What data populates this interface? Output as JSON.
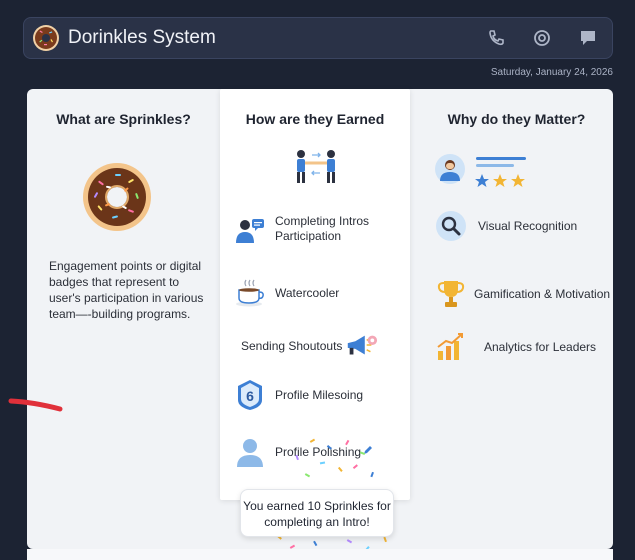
{
  "header": {
    "title": "Dorinkles System",
    "date": "Saturday, January 24, 2026",
    "actions": [
      "phone-icon",
      "settings-icon",
      "chat-icon"
    ]
  },
  "columns": {
    "left": {
      "title": "What are Sprinkles?",
      "definition": "Engagement points or digital badges that represent to user's participation in various team—-building programs."
    },
    "middle": {
      "title": "How are they Earned",
      "items": [
        {
          "label": "Completing Intros Participation",
          "icon": "user-chat-icon"
        },
        {
          "label": "Watercooler",
          "icon": "coffee-cup-icon"
        },
        {
          "label": "Sending Shoutouts",
          "icon": "megaphone-icon"
        },
        {
          "label": "Profile Milesoing",
          "icon": "badge-six-icon"
        },
        {
          "label": "Profile Polishing",
          "icon": "profile-pencil-icon"
        }
      ]
    },
    "right": {
      "title": "Why do they Matter?",
      "items": [
        {
          "label": "Visual Recognition",
          "icon": "magnifier-icon"
        },
        {
          "label": "Gamification & Motivation",
          "icon": "trophy-icon"
        },
        {
          "label": "Analytics for Leaders",
          "icon": "bar-chart-icon"
        }
      ]
    }
  },
  "toast": {
    "message": "You earned 10 Sprinkles for completing an Intro!"
  },
  "colors": {
    "background": "#1c2333",
    "header": "#2a3247",
    "panel": "#f1f3f6",
    "accent_blue": "#3d7fd4",
    "star_gold": "#f2b534"
  }
}
